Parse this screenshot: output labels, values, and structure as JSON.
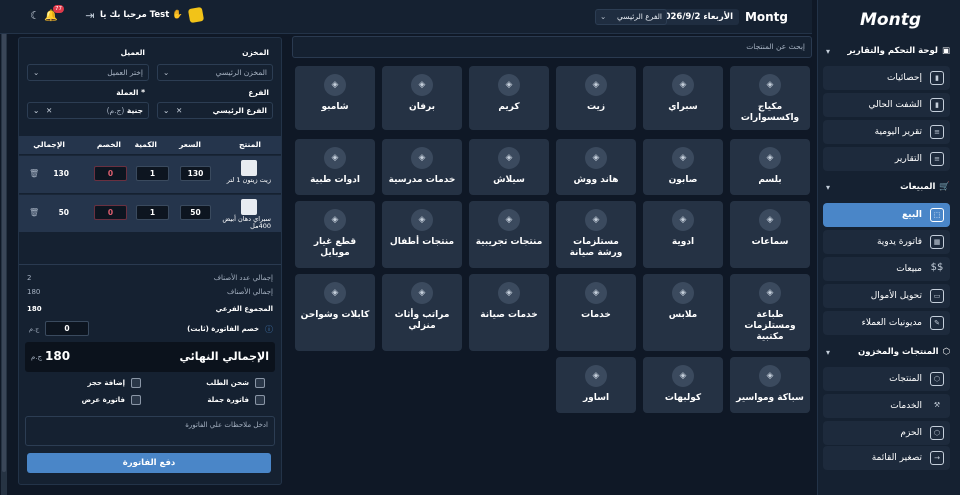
{
  "topbar": {
    "brand": "Montg",
    "date": "الأربعاء 2026/9/2",
    "branch_select": "الفرع الرئيسي",
    "welcome": "مرحبا بك يا Test ✋",
    "notification_count": "77"
  },
  "sidebar": {
    "logo": "Montg",
    "sections": [
      {
        "label": "لوحة التحكم والتقارير",
        "items": [
          "إحصائيات",
          "الشفت الحالي",
          "تقرير اليومية",
          "التقارير"
        ]
      },
      {
        "label": "المبيعات",
        "items": [
          "البيع",
          "فاتورة يدوية",
          "مبيعات",
          "تحويل الأموال",
          "مديونيات العملاء"
        ]
      },
      {
        "label": "المنتجات والمخزون",
        "items": [
          "المنتجات",
          "الخدمات",
          "الحزم"
        ]
      }
    ],
    "collapse_label": "تصغير القائمة",
    "active_item": "البيع"
  },
  "search": {
    "placeholder": "إبحث عن المنتجات"
  },
  "categories": [
    [
      "مكياج واكسسوارات",
      "سبراي",
      "زيت",
      "كريم",
      "برفان",
      "شامبو"
    ],
    [
      "بلسم",
      "صابون",
      "هاند ووش",
      "سيلاش",
      "خدمات مدرسية",
      "ادوات طبية"
    ],
    [
      "سماعات",
      "ادوية",
      "مستلزمات ورشة صيانة",
      "منتجات تجريبية",
      "منتجات أطفال",
      "قطع غيار موبايل"
    ],
    [
      "طباعة ومستلزمات مكتبية",
      "ملابس",
      "خدمات",
      "خدمات صيانة",
      "مراتب وأثاث منزلي",
      "كابلات وشواحن"
    ],
    [
      "سباكة ومواسير",
      "كولبهات",
      "اساور"
    ]
  ],
  "panel": {
    "warehouse_label": "المخزن",
    "warehouse_value": "المخزن الرئيسي",
    "customer_label": "العميل",
    "customer_placeholder": "إختر العميل",
    "branch_label": "الفرع",
    "branch_value": "الفرع الرئيسي",
    "currency_label": "العملة *",
    "currency_value": "جنية",
    "currency_unit": "(ج.م)",
    "table_headers": {
      "product": "المنتج",
      "price": "السعر",
      "qty": "الكمية",
      "discount": "الخصم",
      "total": "الإجمالي"
    },
    "rows": [
      {
        "name": "زيت زيتون 1 لتر",
        "price": "130",
        "qty": "1",
        "discount": "0",
        "total": "130"
      },
      {
        "name": "سبراي دهان أبيض 400مل",
        "price": "50",
        "qty": "1",
        "discount": "0",
        "total": "50"
      }
    ],
    "summary": {
      "items_count_label": "إجمالي عدد الأصناف",
      "items_count": "2",
      "items_total_label": "إجمالي الأصناف",
      "items_total": "180",
      "subtotal_label": "المجموع الفرعي",
      "subtotal": "180",
      "invoice_discount_label": "خصم الفاتورة (ثابت)",
      "invoice_discount": "0",
      "discount_unit": "ج.م"
    },
    "final_label": "الإجمالي النهائي",
    "final_value": "180",
    "final_unit": "ج.م",
    "options": [
      "شحن الطلب",
      "إضافة حجز",
      "فاتورة جملة",
      "فاتورة عرض"
    ],
    "notes_placeholder": "ادخل ملاحظات علي الفاتورة",
    "pay_button": "دفع الفاتورة"
  }
}
